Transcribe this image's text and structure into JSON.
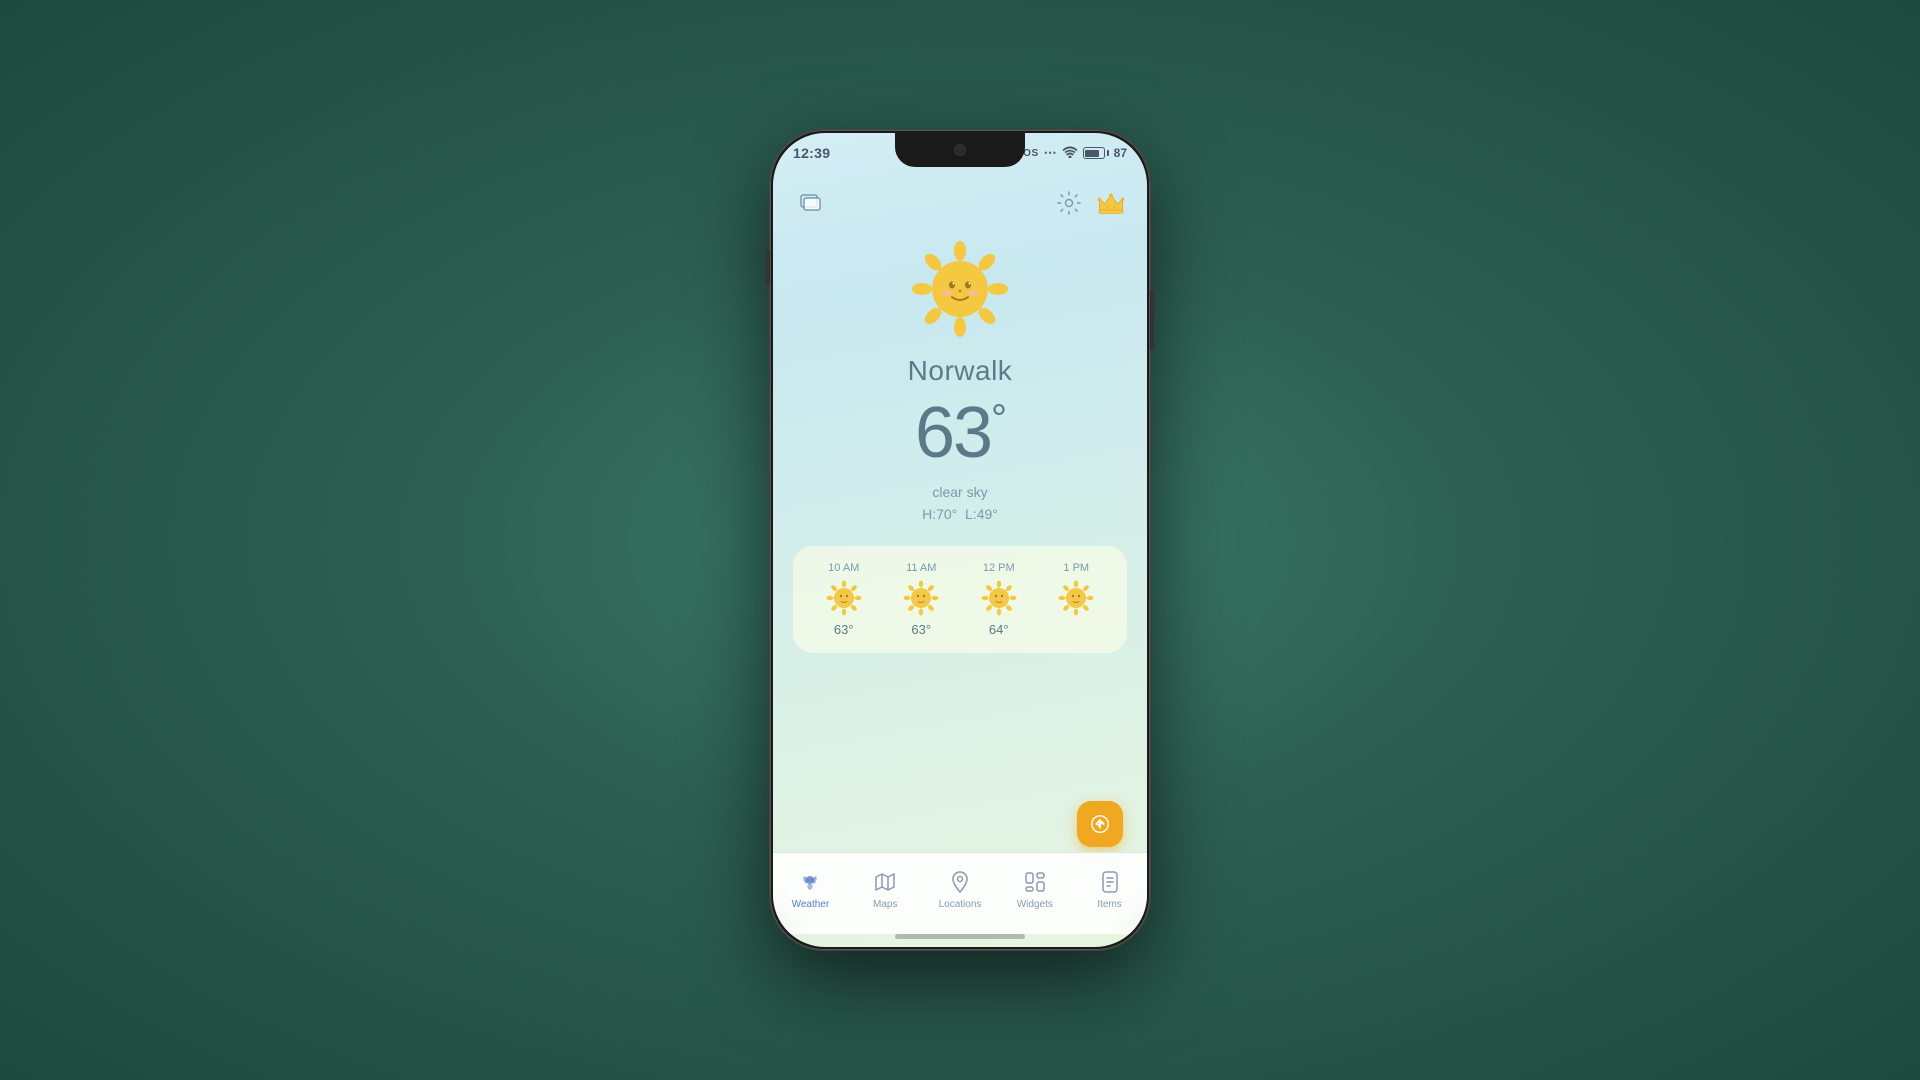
{
  "statusBar": {
    "time": "12:39",
    "sos": "SOS",
    "battery": "87"
  },
  "header": {
    "layersIcon": "layers-icon",
    "settingsIcon": "settings-icon",
    "crownIcon": "crown-icon"
  },
  "weather": {
    "location": "Norwalk",
    "temperature": "63",
    "tempUnit": "°",
    "description": "clear sky",
    "high": "H:70°",
    "low": "L:49°"
  },
  "hourly": [
    {
      "time": "10 AM",
      "temp": "63°"
    },
    {
      "time": "11 AM",
      "temp": "63°"
    },
    {
      "time": "12 PM",
      "temp": "64°"
    },
    {
      "time": "1 PM",
      "temp": ""
    }
  ],
  "tabs": [
    {
      "id": "weather",
      "label": "Weather",
      "active": true
    },
    {
      "id": "maps",
      "label": "Maps",
      "active": false
    },
    {
      "id": "locations",
      "label": "Locations",
      "active": false
    },
    {
      "id": "widgets",
      "label": "Widgets",
      "active": false
    },
    {
      "id": "items",
      "label": "Items",
      "active": false
    }
  ],
  "colors": {
    "background": "#2d6055",
    "phoneGradientStart": "#d4eef5",
    "activeTab": "#5a7ac8",
    "inactiveTab": "#8a9ab0",
    "shareButton": "#f0a820",
    "tempText": "#5a7a8a",
    "sunYellow": "#f5c842"
  }
}
